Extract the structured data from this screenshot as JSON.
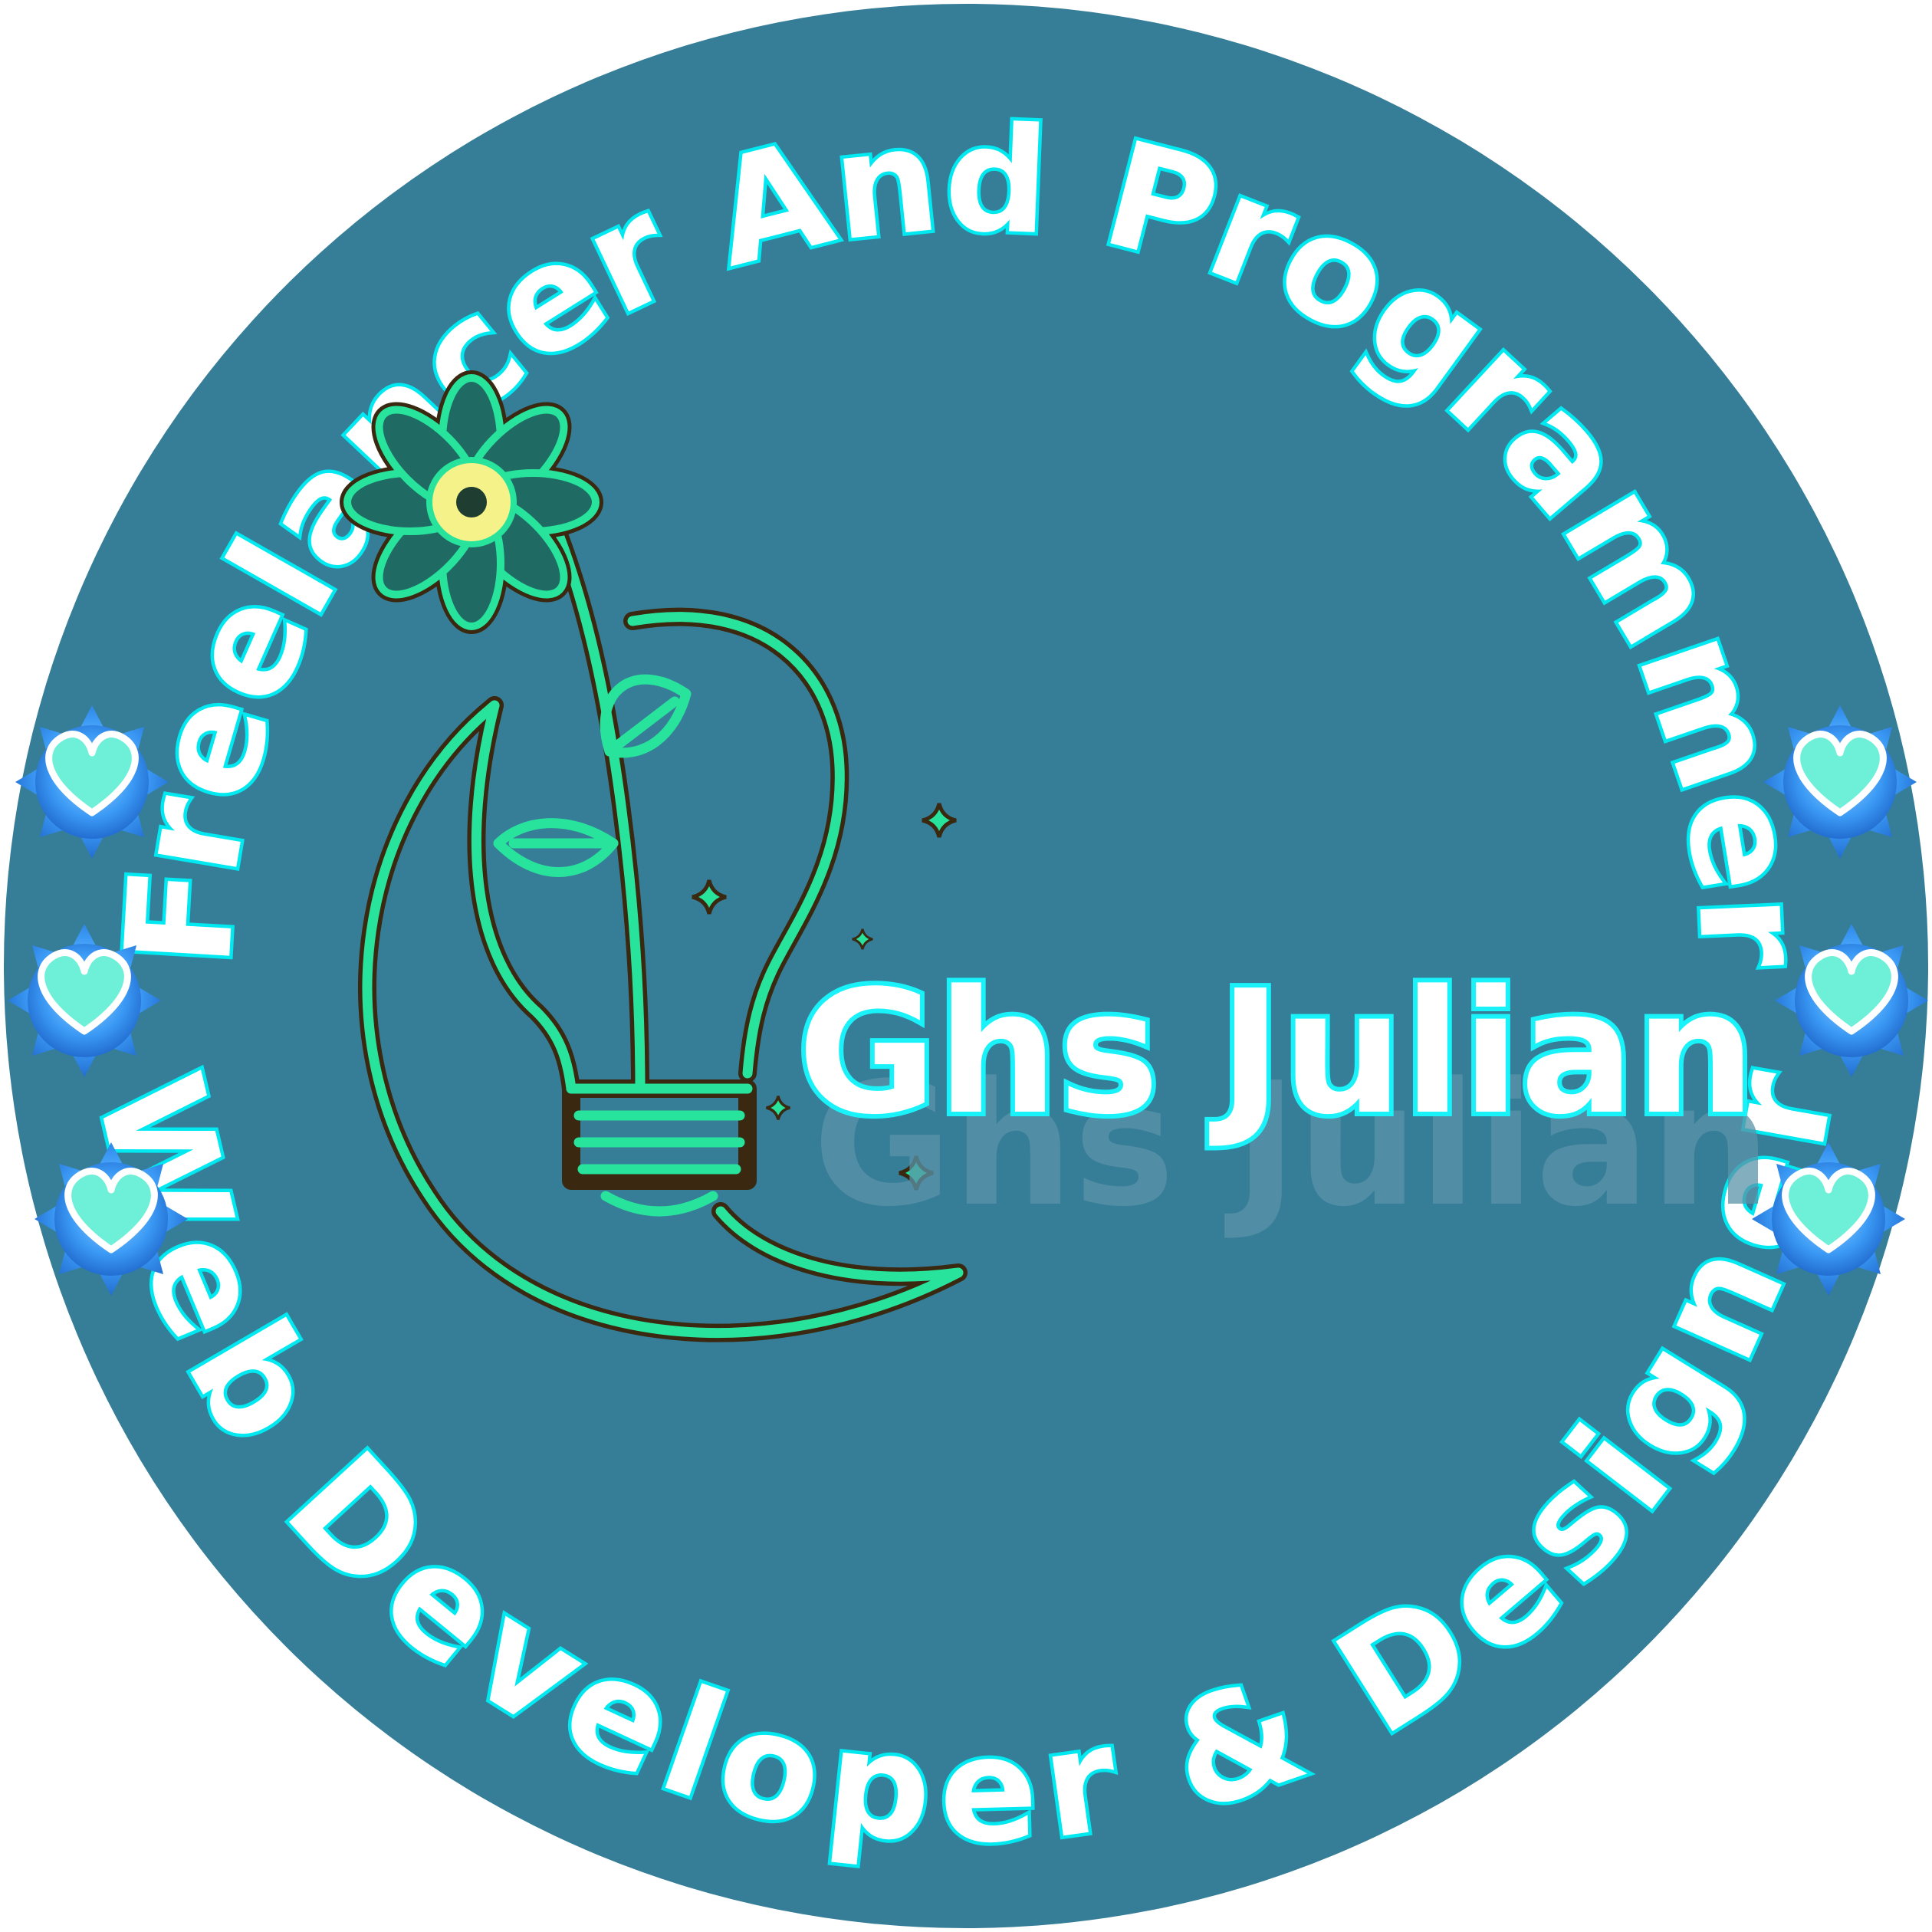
{
  "badge": {
    "top_text": "Freelancer And Programmer",
    "bottom_text": "Web Developer & Designer",
    "name": "Ghs Julian",
    "colors": {
      "background_circle": "#367e97",
      "text_fill": "#ffffff",
      "text_glow": "#00eaf2",
      "icon_line": "#27e39c",
      "icon_outline": "#3a2810",
      "flower_center": "#f5f28a",
      "heart_badge": "#2f8ff0",
      "heart_fill": "#6ef0d8"
    },
    "icons": {
      "logo": "lightbulb-flower-moon-icon",
      "side_decoration": "heart-flower-icon",
      "sparkle": "sparkle-star-icon"
    }
  }
}
